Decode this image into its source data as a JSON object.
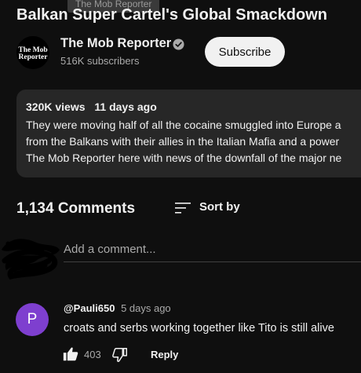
{
  "tooltip": "The Mob Reporter",
  "video": {
    "title": "Balkan Super Cartel's Global Smackdown"
  },
  "channel": {
    "name": "The Mob Reporter",
    "subscribers": "516K subscribers",
    "avatar_text_line1": "The Mob",
    "avatar_text_line2": "Reporter",
    "subscribe_label": "Subscribe"
  },
  "description": {
    "views": "320K views",
    "age": "11 days ago",
    "lines": [
      "They were moving half of all the cocaine smuggled into Europe a",
      "from the Balkans with their allies in the Italian Mafia and a power",
      "The Mob Reporter here with news of the downfall of the major ne"
    ]
  },
  "comments": {
    "count_label": "1,134 Comments",
    "sort_label": "Sort by",
    "add_placeholder": "Add a comment...",
    "items": [
      {
        "avatar_letter": "P",
        "avatar_color": "#7e3fcf",
        "handle": "@Pauli650",
        "time": "5 days ago",
        "text": "croats and serbs working together like Tito is still alive",
        "likes": "403",
        "reply_label": "Reply"
      }
    ]
  },
  "icons": {
    "verified": "verified-check-icon",
    "sort": "sort-icon",
    "like": "thumbs-up-icon",
    "dislike": "thumbs-down-icon"
  },
  "colors": {
    "background": "#0f0f0f",
    "panel": "#272727",
    "secondary_text": "#aaaaaa",
    "subscribe_bg": "#f1f1f1"
  }
}
